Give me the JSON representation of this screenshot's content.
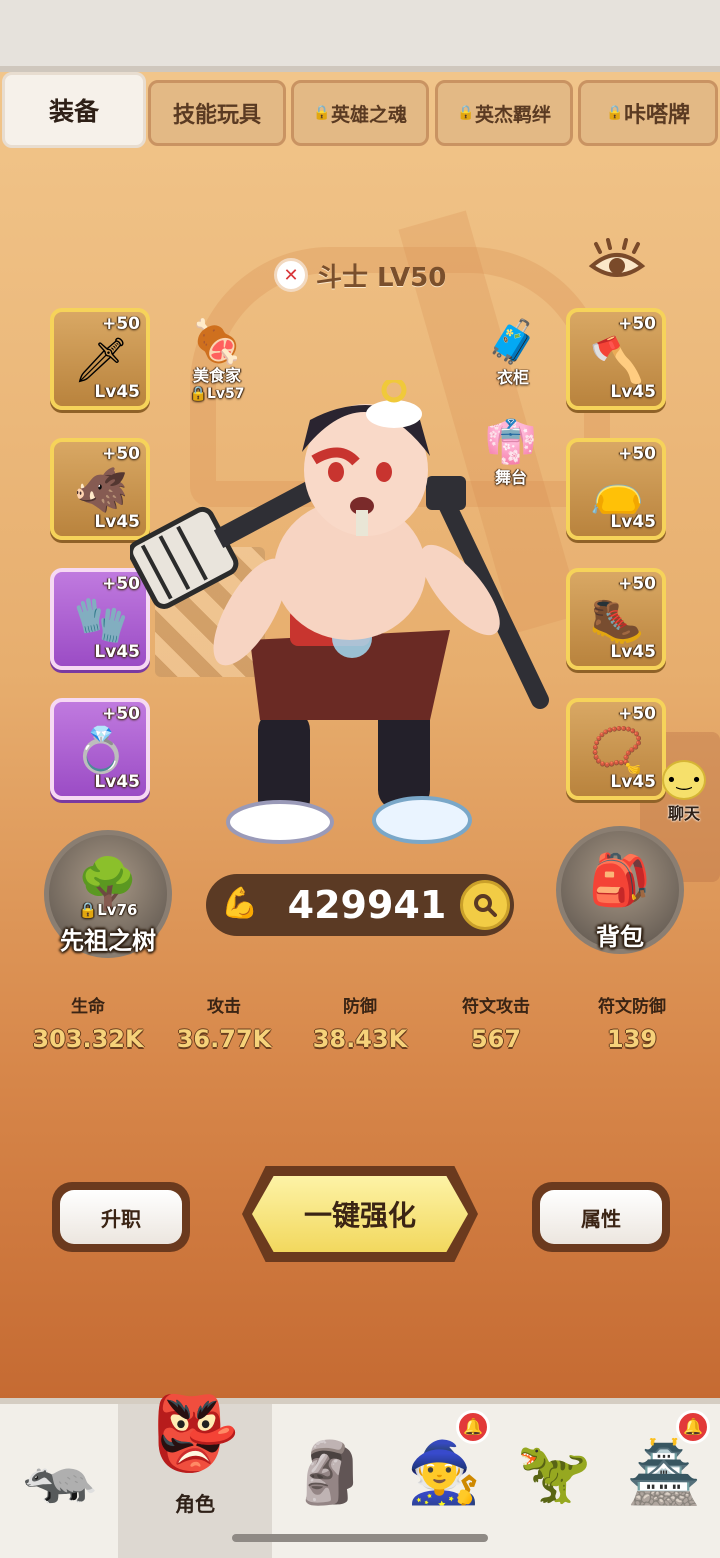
{
  "tabs": [
    {
      "label": "装备",
      "locked": false,
      "active": true
    },
    {
      "label": "技能玩具",
      "locked": false,
      "active": false
    },
    {
      "label": "英雄之魂",
      "locked": true,
      "active": false
    },
    {
      "label": "英杰羁绊",
      "locked": true,
      "active": false
    },
    {
      "label": "咔嗒牌",
      "locked": true,
      "active": false
    }
  ],
  "hero": {
    "class_name": "斗士 LV50"
  },
  "equipment": {
    "left": [
      {
        "plus": "+50",
        "level": "Lv45",
        "rarity": "gold",
        "icon": "spiked-club-icon"
      },
      {
        "plus": "+50",
        "level": "Lv45",
        "rarity": "gold",
        "icon": "boar-mask-icon"
      },
      {
        "plus": "+50",
        "level": "Lv45",
        "rarity": "purple",
        "icon": "tusk-gauntlet-icon"
      },
      {
        "plus": "+50",
        "level": "Lv45",
        "rarity": "purple",
        "icon": "ring-icon"
      }
    ],
    "right": [
      {
        "plus": "+50",
        "level": "Lv45",
        "rarity": "gold",
        "icon": "bone-axe-icon"
      },
      {
        "plus": "+50",
        "level": "Lv45",
        "rarity": "gold",
        "icon": "armor-skirt-icon"
      },
      {
        "plus": "+50",
        "level": "Lv45",
        "rarity": "gold",
        "icon": "fur-boots-icon"
      },
      {
        "plus": "+50",
        "level": "Lv45",
        "rarity": "gold",
        "icon": "bone-necklace-icon"
      }
    ]
  },
  "cosmetics": {
    "gourmet": {
      "label": "美食家",
      "level": "Lv57",
      "locked": true
    },
    "wardrobe": {
      "label": "衣柜"
    },
    "stage": {
      "label": "舞台"
    }
  },
  "chat": {
    "label": "聊天"
  },
  "ancestor_tree": {
    "label": "先祖之树",
    "level": "Lv76",
    "locked": true
  },
  "bag": {
    "label": "背包"
  },
  "power": {
    "value": "429941"
  },
  "stats": [
    {
      "label": "生命",
      "value": "303.32K"
    },
    {
      "label": "攻击",
      "value": "36.77K"
    },
    {
      "label": "防御",
      "value": "38.43K"
    },
    {
      "label": "符文攻击",
      "value": "567"
    },
    {
      "label": "符文防御",
      "value": "139"
    }
  ],
  "actions": {
    "promote": "升职",
    "enhance_all": "一键强化",
    "attributes": "属性"
  },
  "bottom_nav": [
    {
      "icon": "tanuki-shop-icon",
      "label": "",
      "active": false,
      "badge": false
    },
    {
      "icon": "hero-mask-icon",
      "label": "角色",
      "active": true,
      "badge": false
    },
    {
      "icon": "totem-icon",
      "label": "",
      "active": false,
      "badge": false
    },
    {
      "icon": "elder-icon",
      "label": "",
      "active": false,
      "badge": true
    },
    {
      "icon": "dino-icon",
      "label": "",
      "active": false,
      "badge": false
    },
    {
      "icon": "tribe-gate-icon",
      "label": "",
      "active": false,
      "badge": true
    }
  ],
  "colors": {
    "accent_gold": "#f6d35a",
    "rarity_purple": "#9b4cc5",
    "stat_value": "#f6d27a",
    "badge_red": "#e23a3a"
  }
}
